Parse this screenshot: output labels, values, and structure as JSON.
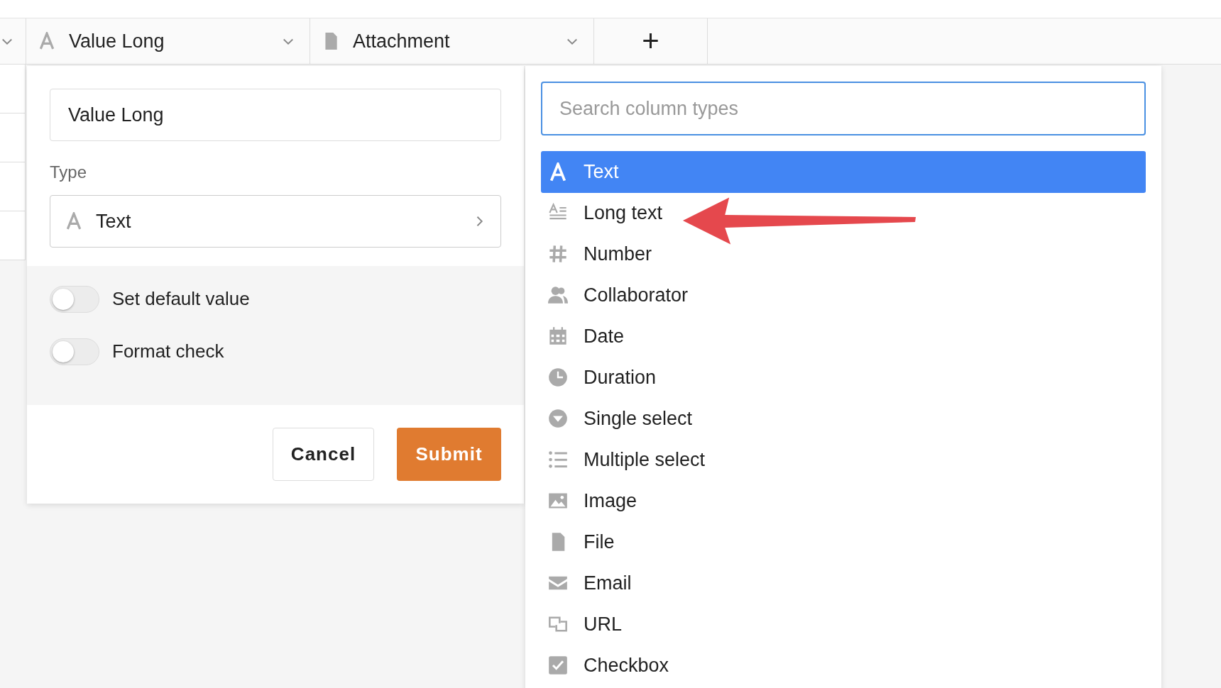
{
  "columns": [
    {
      "label": "Value Long",
      "kind": "text"
    },
    {
      "label": "Attachment",
      "kind": "file"
    }
  ],
  "add_column": "+",
  "editor": {
    "name_value": "Value Long",
    "type_label": "Type",
    "type_value": "Text",
    "toggles": [
      {
        "label": "Set default value",
        "on": false
      },
      {
        "label": "Format check",
        "on": false
      }
    ],
    "cancel": "Cancel",
    "submit": "Submit"
  },
  "type_picker": {
    "placeholder": "Search column types",
    "items": [
      {
        "label": "Text",
        "kind": "text",
        "selected": true
      },
      {
        "label": "Long text",
        "kind": "long-text",
        "selected": false
      },
      {
        "label": "Number",
        "kind": "number",
        "selected": false
      },
      {
        "label": "Collaborator",
        "kind": "collaborator",
        "selected": false
      },
      {
        "label": "Date",
        "kind": "date",
        "selected": false
      },
      {
        "label": "Duration",
        "kind": "duration",
        "selected": false
      },
      {
        "label": "Single select",
        "kind": "single-select",
        "selected": false
      },
      {
        "label": "Multiple select",
        "kind": "multiple-select",
        "selected": false
      },
      {
        "label": "Image",
        "kind": "image",
        "selected": false
      },
      {
        "label": "File",
        "kind": "file",
        "selected": false
      },
      {
        "label": "Email",
        "kind": "email",
        "selected": false
      },
      {
        "label": "URL",
        "kind": "url",
        "selected": false
      },
      {
        "label": "Checkbox",
        "kind": "checkbox",
        "selected": false
      }
    ]
  }
}
